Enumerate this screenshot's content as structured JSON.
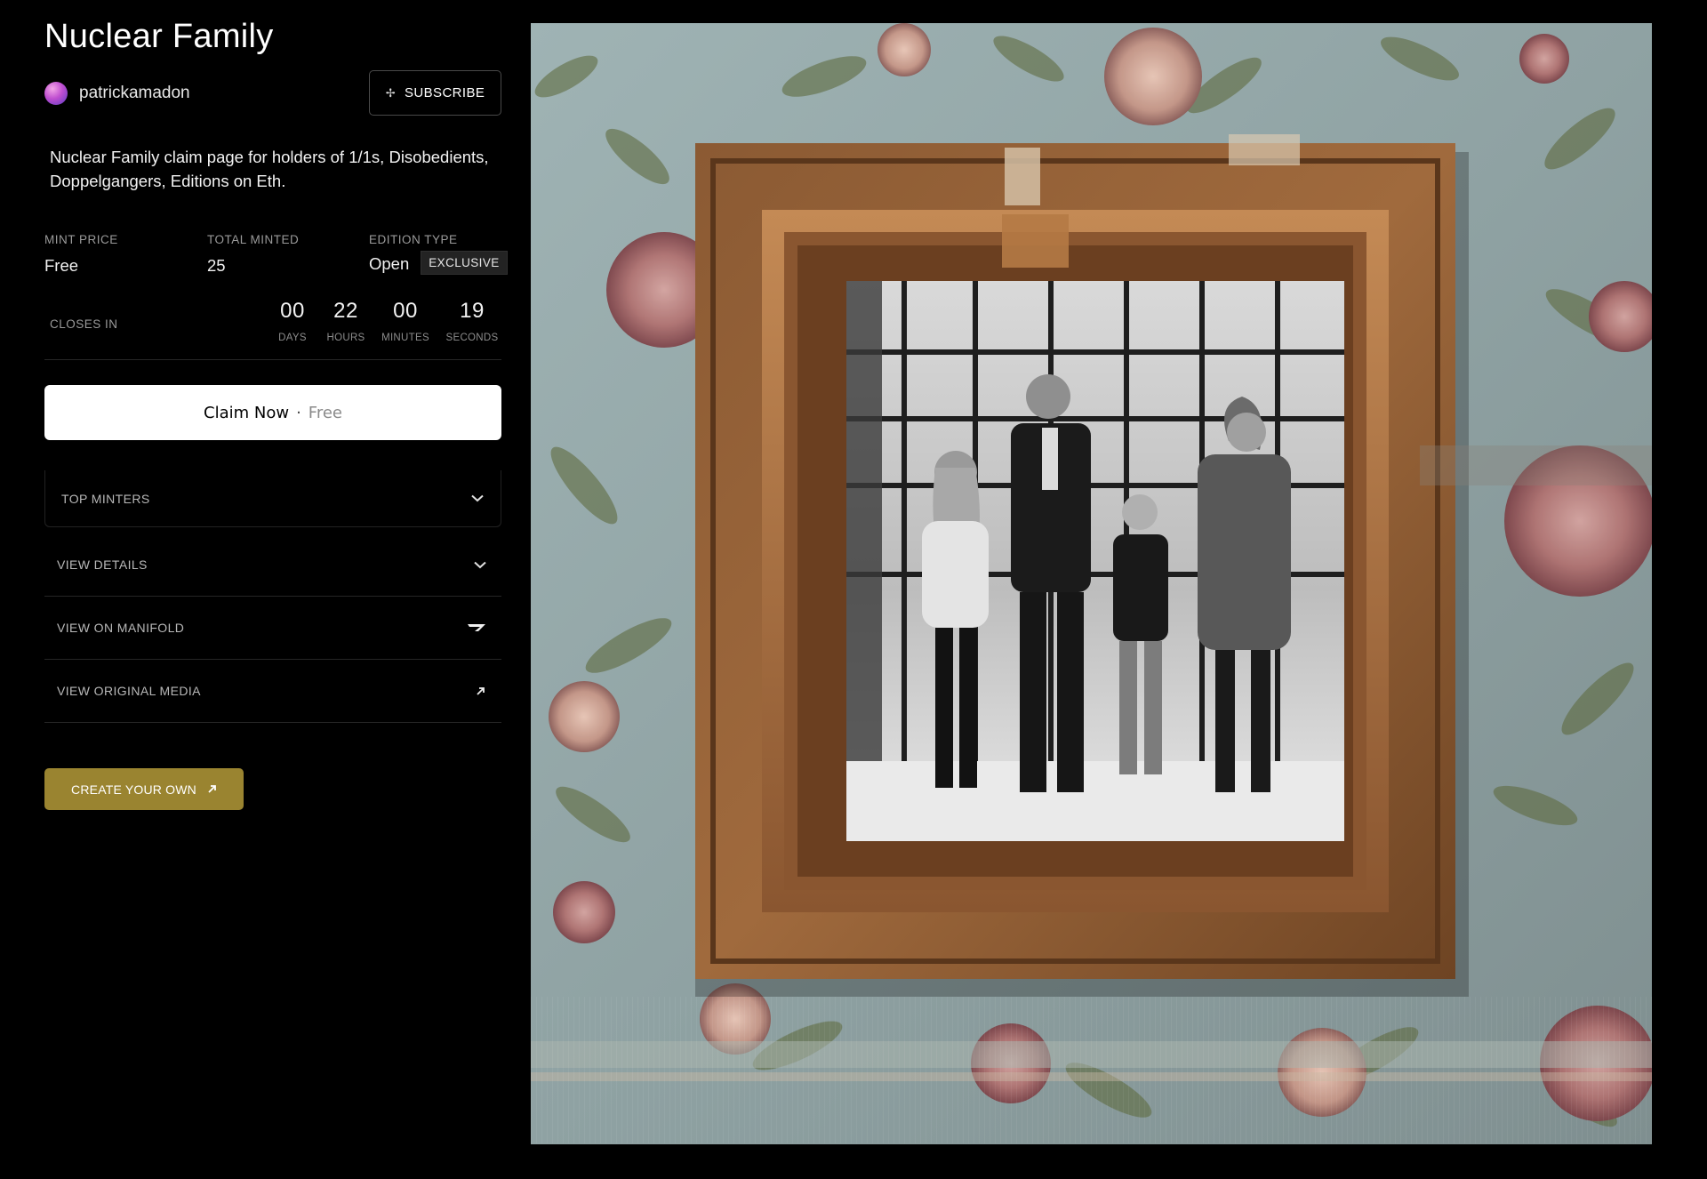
{
  "title": "Nuclear Family",
  "creator": {
    "name": "patrickamadon"
  },
  "subscribe": {
    "label": "SUBSCRIBE",
    "icon": "sparkle-icon"
  },
  "description": "Nuclear Family claim page for holders of 1/1s, Disobedients, Doppelgangers, Editions on Eth.",
  "stats": {
    "mint_price": {
      "label": "MINT PRICE",
      "value": "Free"
    },
    "total_minted": {
      "label": "TOTAL MINTED",
      "value": "25"
    },
    "edition_type": {
      "label": "EDITION TYPE",
      "value": "Open",
      "badge": "EXCLUSIVE"
    }
  },
  "countdown": {
    "label": "CLOSES IN",
    "days": {
      "value": "00",
      "label": "DAYS"
    },
    "hours": {
      "value": "22",
      "label": "HOURS"
    },
    "minutes": {
      "value": "00",
      "label": "MINUTES"
    },
    "seconds": {
      "value": "19",
      "label": "SECONDS"
    }
  },
  "claim": {
    "label": "Claim Now",
    "separator": "·",
    "price": "Free"
  },
  "accordions": {
    "top_minters": {
      "label": "TOP MINTERS",
      "icon": "chevron-down-icon"
    },
    "view_details": {
      "label": "VIEW DETAILS",
      "icon": "chevron-down-icon"
    },
    "view_on_manifold": {
      "label": "VIEW ON MANIFOLD",
      "icon": "manifold-logo-icon"
    },
    "view_original_media": {
      "label": "VIEW ORIGINAL MEDIA",
      "icon": "arrow-up-right-icon"
    }
  },
  "create": {
    "label": "CREATE YOUR OWN",
    "icon": "arrow-up-right-icon"
  },
  "colors": {
    "background": "#000000",
    "claim_button": "#ffffff",
    "create_button": "#9a8430",
    "muted_text": "#9a9a9a"
  }
}
